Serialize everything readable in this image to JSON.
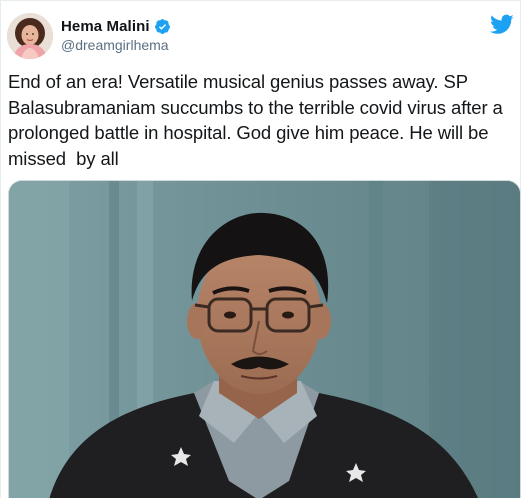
{
  "author": {
    "display_name": "Hema Malini",
    "handle": "@dreamgirlhema",
    "verified": true,
    "avatar_icon": "profile-photo"
  },
  "tweet": {
    "text": "End of an era! Versatile musical genius passes away. SP Balasubramaniam succumbs to the terrible covid virus after a prolonged battle in hospital. God give him peace. He will be missed  by all"
  },
  "media": {
    "type": "photo",
    "icon": "portrait-photo"
  },
  "icons": {
    "verified": "verified-badge-icon",
    "brand": "twitter-bird-icon"
  },
  "colors": {
    "twitter_blue": "#1da1f2",
    "text": "#14171a",
    "secondary_text": "#5b7083",
    "border": "#e6ecf0"
  }
}
